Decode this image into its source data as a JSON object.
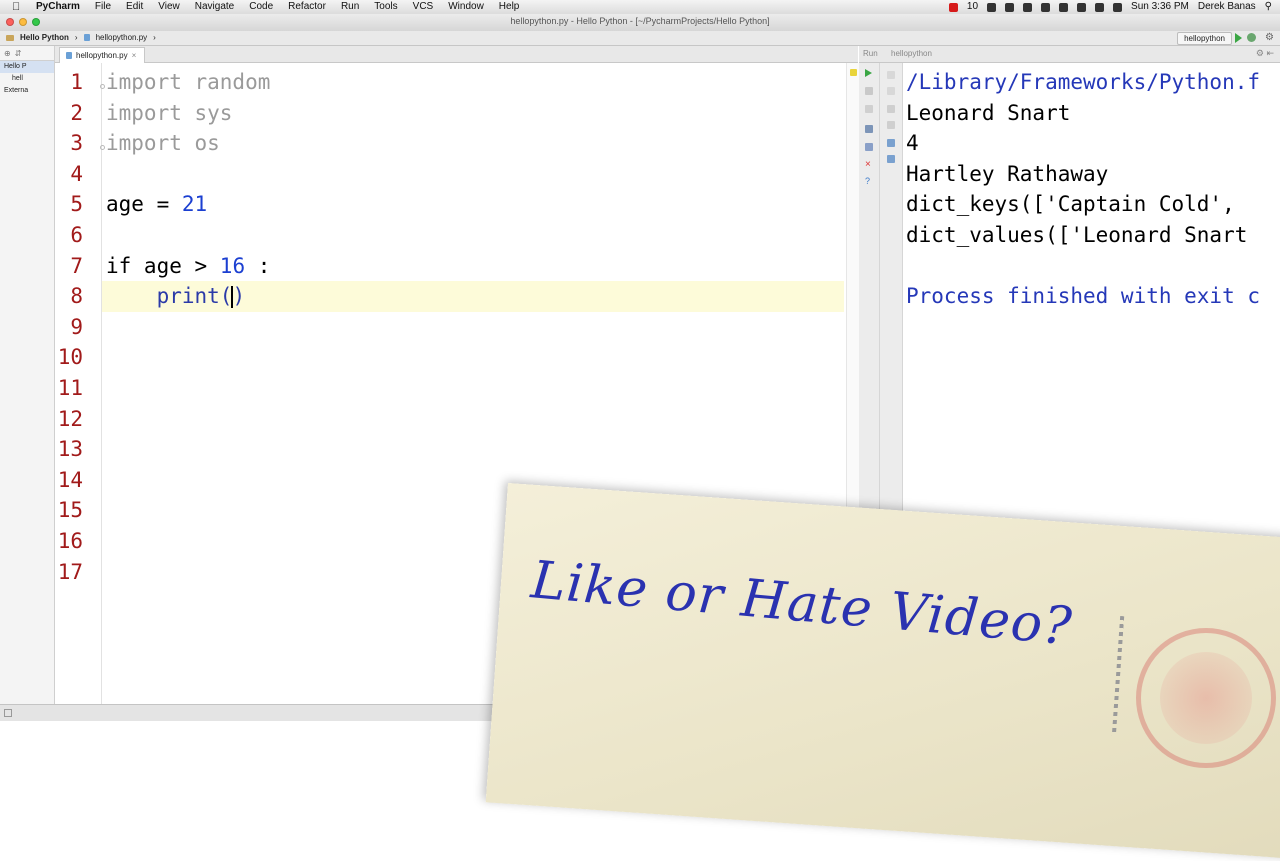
{
  "menubar": {
    "app": "PyCharm",
    "items": [
      "File",
      "Edit",
      "View",
      "Navigate",
      "Code",
      "Refactor",
      "Run",
      "Tools",
      "VCS",
      "Window",
      "Help"
    ],
    "status_num": "10",
    "clock": "Sun 3:36 PM",
    "user": "Derek Banas"
  },
  "window": {
    "title": "hellopython.py - Hello Python - [~/PycharmProjects/Hello Python]"
  },
  "navbar": {
    "project": "Hello Python",
    "file": "hellopython.py",
    "run_config": "hellopython"
  },
  "project_panel": {
    "rows": [
      "Hello P",
      "hell",
      "Externa"
    ]
  },
  "editor": {
    "tab": "hellopython.py",
    "line_numbers": [
      "1",
      "2",
      "3",
      "4",
      "5",
      "6",
      "7",
      "8",
      "9",
      "10",
      "11",
      "12",
      "13",
      "14",
      "15",
      "16",
      "17"
    ],
    "code": {
      "l1": "import random",
      "l2": "import sys",
      "l3": "import os",
      "l5_var": "age = ",
      "l5_num": "21",
      "l7_pre": "if age > ",
      "l7_num": "16",
      "l7_post": " :",
      "l8_fn": "    print(",
      "l8_close": ")"
    }
  },
  "run_panel": {
    "label": "Run",
    "name": "hellopython",
    "console": [
      "/Library/Frameworks/Python.f",
      "Leonard Snart",
      "4",
      "Hartley Rathaway",
      "dict_keys(['Captain Cold',",
      "dict_values(['Leonard Snart",
      "",
      "Process finished with exit c"
    ]
  },
  "overlay": {
    "message": "Like or Hate Video?"
  },
  "colors": {
    "line_number": "#a11a1a",
    "number_literal": "#1b3fd1",
    "console_exit": "#2538b8",
    "overlay_text": "#2a32b0"
  }
}
